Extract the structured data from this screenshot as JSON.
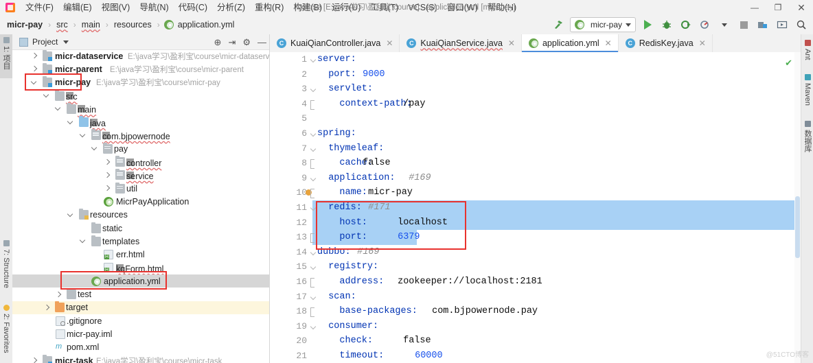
{
  "window": {
    "title": "course [E:\\java学习\\盈利宝\\course] - application.yml [micr-pay]",
    "menu": [
      "文件(F)",
      "编辑(E)",
      "视图(V)",
      "导航(N)",
      "代码(C)",
      "分析(Z)",
      "重构(R)",
      "构建(B)",
      "运行(U)",
      "工具(T)",
      "VCS(S)",
      "窗口(W)",
      "帮助(H)"
    ],
    "minimize": "—",
    "maximize": "❐",
    "close": "✕"
  },
  "navbar": {
    "breadcrumb": [
      "micr-pay",
      "src",
      "main",
      "resources",
      "application.yml"
    ],
    "separator": "›",
    "run_config": "micr-pay"
  },
  "left_tool_bar": [
    "1: 项目",
    "7: Structure",
    "2: Favorites"
  ],
  "right_tool_bar": [
    "Ant",
    "Maven",
    "数据库"
  ],
  "project_panel": {
    "title": "Project",
    "tree": [
      {
        "label": "micr-dataservice",
        "path": "E:\\java学习\\盈利宝\\course\\micr-dataservice"
      },
      {
        "label": "micr-parent",
        "path": "E:\\java学习\\盈利宝\\course\\micr-parent"
      },
      {
        "label": "micr-pay",
        "path": "E:\\java学习\\盈利宝\\course\\micr-pay"
      },
      {
        "label": "src",
        "path": ""
      },
      {
        "label": "main",
        "path": ""
      },
      {
        "label": "java",
        "path": ""
      },
      {
        "label": "com.bjpowernode",
        "path": ""
      },
      {
        "label": "pay",
        "path": ""
      },
      {
        "label": "controller",
        "path": ""
      },
      {
        "label": "service",
        "path": ""
      },
      {
        "label": "util",
        "path": ""
      },
      {
        "label": "MicrPayApplication",
        "path": ""
      },
      {
        "label": "resources",
        "path": ""
      },
      {
        "label": "static",
        "path": ""
      },
      {
        "label": "templates",
        "path": ""
      },
      {
        "label": "err.html",
        "path": ""
      },
      {
        "label": "kqForm.html",
        "path": ""
      },
      {
        "label": "application.yml",
        "path": ""
      },
      {
        "label": "test",
        "path": ""
      },
      {
        "label": "target",
        "path": ""
      },
      {
        "label": ".gitignore",
        "path": ""
      },
      {
        "label": "micr-pay.iml",
        "path": ""
      },
      {
        "label": "pom.xml",
        "path": ""
      },
      {
        "label": "micr-task",
        "path": "E:\\java学习\\盈利宝\\course\\micr-task"
      }
    ]
  },
  "editor": {
    "tabs": [
      {
        "label": "KuaiQianController.java",
        "close": "✕"
      },
      {
        "label": "KuaiQianService.java",
        "close": "✕"
      },
      {
        "label": "application.yml",
        "close": "✕"
      },
      {
        "label": "RedisKey.java",
        "close": "✕"
      }
    ],
    "inspection_ok": "✔",
    "lines": [
      {
        "n": "1",
        "a": "server:",
        "b": ""
      },
      {
        "n": "2",
        "a": "  port:",
        "b": " 9000"
      },
      {
        "n": "3",
        "a": "  servlet:",
        "b": ""
      },
      {
        "n": "4",
        "a": "    context-path:",
        "b": " /pay"
      },
      {
        "n": "5",
        "a": "",
        "b": ""
      },
      {
        "n": "6",
        "a": "spring:",
        "b": ""
      },
      {
        "n": "7",
        "a": "  thymeleaf:",
        "b": ""
      },
      {
        "n": "8",
        "a": "    cache:",
        "b": " false"
      },
      {
        "n": "9",
        "a": "  application:",
        "b": "  #169"
      },
      {
        "n": "10",
        "a": "    name:",
        "b": " micr-pay"
      },
      {
        "n": "11",
        "a": "  redis:",
        "b": " #171"
      },
      {
        "n": "12",
        "a": "    host:",
        "b": " localhost"
      },
      {
        "n": "13",
        "a": "    port:",
        "b": " 6379"
      },
      {
        "n": "14",
        "a": "dubbo:",
        "b": " #169"
      },
      {
        "n": "15",
        "a": "  registry:",
        "b": ""
      },
      {
        "n": "16",
        "a": "    address:",
        "b": " zookeeper://localhost:2181"
      },
      {
        "n": "17",
        "a": "  scan:",
        "b": ""
      },
      {
        "n": "18",
        "a": "    base-packages:",
        "b": " com.bjpowernode.pay"
      },
      {
        "n": "19",
        "a": "  consumer:",
        "b": ""
      },
      {
        "n": "20",
        "a": "    check:",
        "b": " false"
      },
      {
        "n": "21",
        "a": "    timeout:",
        "b": " 60000"
      }
    ]
  },
  "watermark": "@51CTO博客",
  "colors": {
    "selection": "#a8d1f5",
    "annotation": "#e8322e",
    "yaml_key": "#0033b3",
    "yaml_number": "#1750eb",
    "yaml_comment": "#8c8c8c"
  }
}
